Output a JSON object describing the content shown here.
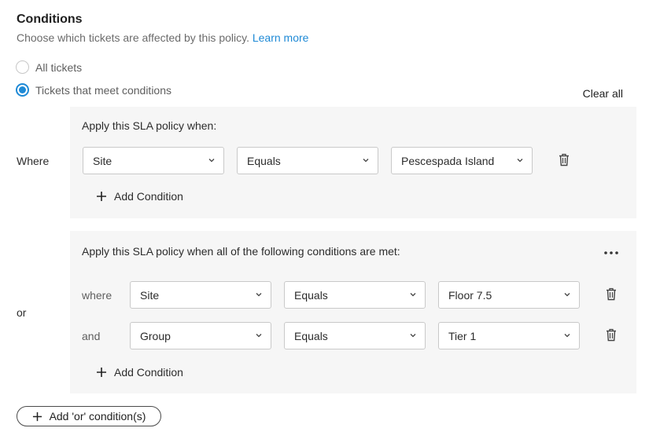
{
  "header": {
    "title": "Conditions",
    "description": "Choose which tickets are affected by this policy.",
    "learn_more": "Learn more"
  },
  "options": {
    "all_tickets": "All tickets",
    "meet_conditions": "Tickets that meet conditions",
    "selected": "meet_conditions"
  },
  "clear_all": "Clear all",
  "first_group": {
    "side_label": "Where",
    "title": "Apply this SLA policy when:",
    "condition": {
      "field": "Site",
      "operator": "Equals",
      "value": "Pescespada Island"
    },
    "add_label": "Add Condition"
  },
  "second_group": {
    "side_label": "or",
    "title": "Apply this SLA policy when all of the following conditions are met:",
    "rows": [
      {
        "label": "where",
        "field": "Site",
        "operator": "Equals",
        "value": "Floor 7.5"
      },
      {
        "label": "and",
        "field": "Group",
        "operator": "Equals",
        "value": "Tier 1"
      }
    ],
    "add_label": "Add Condition"
  },
  "add_or_label": "Add 'or' condition(s)",
  "icons": {
    "delete": "trash-icon",
    "dropdown": "chevron-down-icon",
    "add": "plus-icon",
    "more": "more-dots-icon"
  },
  "colors": {
    "accent": "#1f8ad6",
    "panel": "#f6f6f6"
  }
}
